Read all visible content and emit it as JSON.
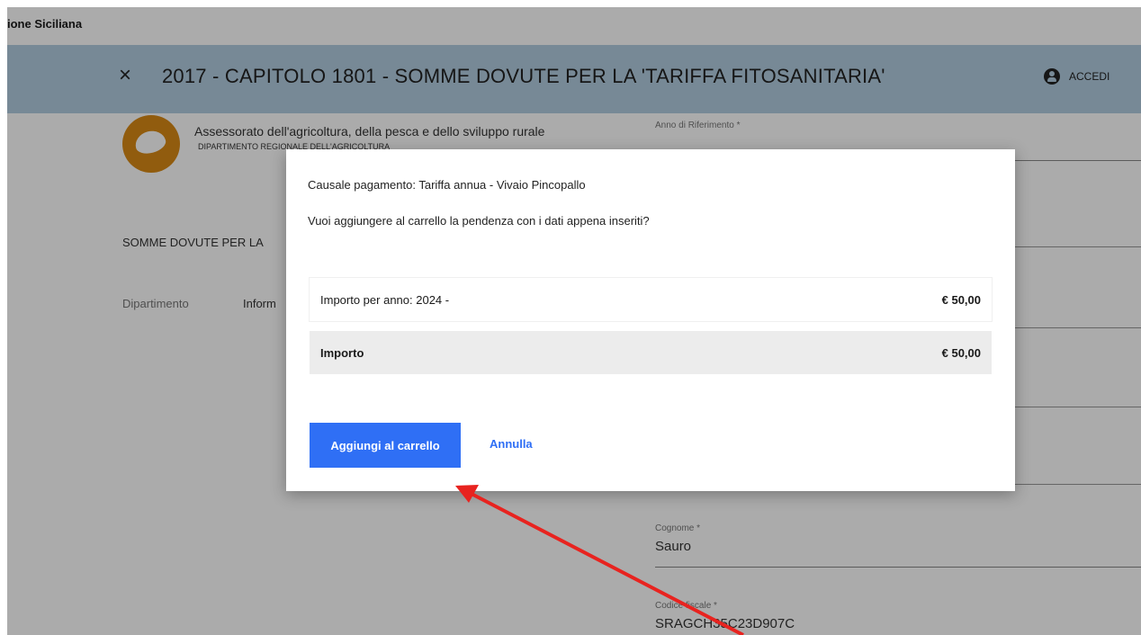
{
  "topbar": {
    "title": "ione Siciliana"
  },
  "header": {
    "close_symbol": "×",
    "title": "2017 - CAPITOLO 1801 - SOMME DOVUTE PER LA 'TARIFFA FITOSANITARIA'",
    "login_label": "ACCEDI",
    "icons": {
      "close": "close-icon",
      "user": "user-icon"
    },
    "background": "#b2cde0"
  },
  "organization": {
    "name": "Assessorato dell'agricoltura, della pesca e dello sviluppo rurale",
    "department": "DIPARTIMENTO REGIONALE DELL'AGRICOLTURA",
    "logo_color": "#d98a16"
  },
  "main": {
    "heading": "SOMME DOVUTE PER LA",
    "tabs": [
      "Dipartimento",
      "Inform"
    ]
  },
  "form": {
    "anno_label": "Anno di Riferimento *",
    "cognome_label": "Cognome *",
    "cognome_value": "Sauro",
    "cf_label": "Codice fiscale *",
    "cf_value": "SRAGCH35C23D907C"
  },
  "modal": {
    "causale": "Causale pagamento: Tariffa annua - Vivaio Pincopallo",
    "question": "Vuoi aggiungere al carrello la pendenza con i dati appena inseriti?",
    "rows": [
      {
        "label": "Importo per anno: 2024 -",
        "amount": "€ 50,00"
      },
      {
        "label": "Importo",
        "amount": "€ 50,00"
      }
    ],
    "add_button": "Aggiungi al carrello",
    "cancel_button": "Annulla",
    "accent_color": "#2f6ff5"
  },
  "annotation": {
    "arrow_color": "#e8231f"
  }
}
